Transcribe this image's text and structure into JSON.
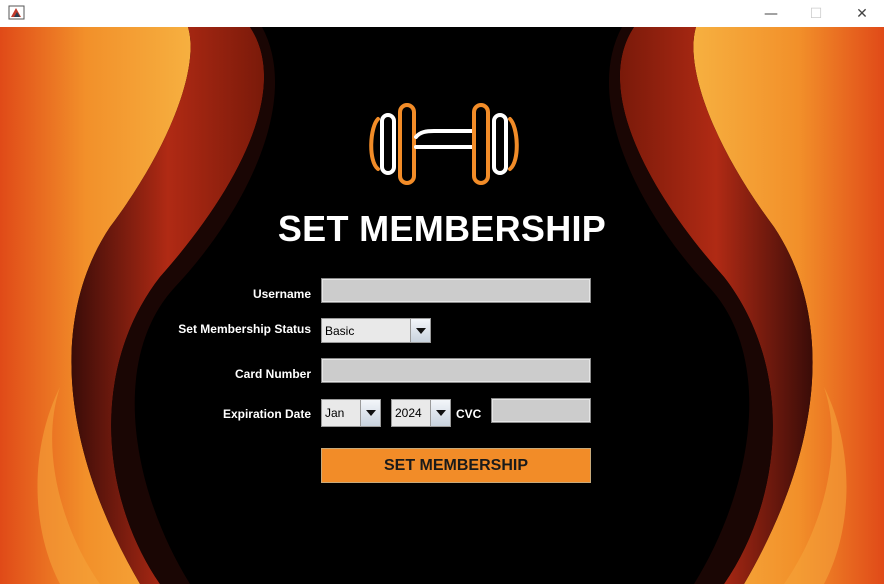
{
  "window": {
    "minimize_glyph": "—",
    "maximize_glyph": "☐",
    "close_glyph": "✕"
  },
  "colors": {
    "accent": "#f28c28",
    "background": "#000000",
    "field": "#cccccc",
    "decor_orange": "#f2a030",
    "decor_red": "#c83a1a"
  },
  "logo": {
    "icon": "dumbbell-icon"
  },
  "form": {
    "title": "SET MEMBERSHIP",
    "username_label": "Username",
    "username_value": "",
    "status_label": "Set Membership Status",
    "status_value": "Basic",
    "card_label": "Card Number",
    "card_value": "",
    "expiration_label": "Expiration Date",
    "month_value": "Jan",
    "year_value": "2024",
    "cvc_label": "CVC",
    "cvc_value": "",
    "submit_label": "SET MEMBERSHIP"
  }
}
